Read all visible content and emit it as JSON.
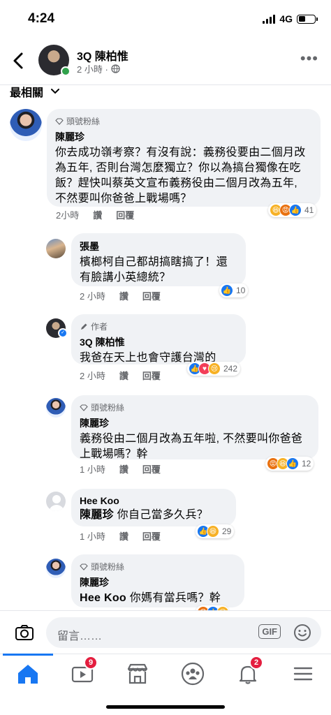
{
  "status": {
    "time": "4:24",
    "network": "4G"
  },
  "header": {
    "name": "3Q 陳柏惟",
    "time": "2 小時 ·"
  },
  "sort_label": "最相關",
  "comments": [
    {
      "badge": "頭號粉絲",
      "name": "陳麗珍",
      "text": "你去成功嶺考察？有沒有說：義務役要由二個月改為五年, 否則台灣怎麼獨立？你以為搞台獨像在吃飯？趕快叫蔡英文宣布義務役由二個月改為五年, 不然要叫你爸爸上戰場嗎？",
      "time": "2小時",
      "like": "讚",
      "reply": "回覆",
      "reaction_count": "41"
    },
    {
      "name": "張墨",
      "text": "檳榔柯自己都胡搞瞎搞了！還有臉講小英總統？",
      "time": "2 小時",
      "like": "讚",
      "reply": "回覆",
      "reaction_count": "10"
    },
    {
      "badge": "作者",
      "name": "3Q 陳柏惟",
      "text": "我爸在天上也會守護台灣的",
      "time": "2 小時",
      "like": "讚",
      "reply": "回覆",
      "reaction_count": "242"
    },
    {
      "badge": "頭號粉絲",
      "name": "陳麗珍",
      "text": "義務役由二個月改為五年啦, 不然要叫你爸爸上戰場嗎？幹",
      "time": "1 小時",
      "like": "讚",
      "reply": "回覆",
      "reaction_count": "12"
    },
    {
      "name": "Hee Koo",
      "tag": "陳麗珍",
      "text": " 你自己當多久兵？",
      "time": "1 小時",
      "like": "讚",
      "reply": "回覆",
      "reaction_count": "29"
    },
    {
      "badge": "頭號粉絲",
      "name": "陳麗珍",
      "tag": "Hee Koo",
      "text": " 你媽有當兵嗎？幹"
    }
  ],
  "composer": {
    "placeholder": "留言……",
    "gif_label": "GIF"
  },
  "tabbar": {
    "video_badge": "9",
    "notif_badge": "2"
  },
  "colors": {
    "accent": "#1877f2",
    "online": "#31a24c",
    "badge_red": "#e41e3f"
  }
}
